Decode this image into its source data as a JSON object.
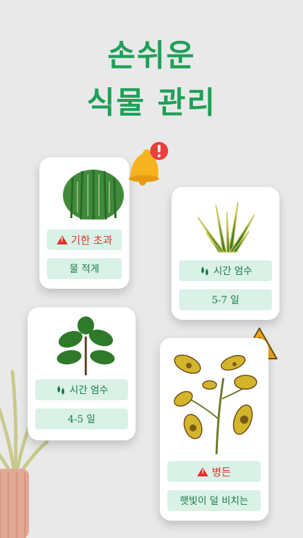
{
  "header": {
    "line1": "손쉬운",
    "line2": "식물 관리"
  },
  "cards": [
    {
      "status": "기한 초과",
      "detail": "물 적게"
    },
    {
      "status": "시간 엄수",
      "detail": "5-7 일"
    },
    {
      "status": "시간 엄수",
      "detail": "4-5 일"
    },
    {
      "status": "병든",
      "detail": "햇빛이 덜 비치는"
    }
  ],
  "icons": {
    "bell": "bell-alert-icon",
    "warning": "warning-triangle-icon",
    "drop": "water-drop-icon"
  },
  "colors": {
    "title": "#1ea05a",
    "pill_bg": "#d9f1e6",
    "pill_text": "#1c7a48",
    "warn": "#e0302e"
  }
}
